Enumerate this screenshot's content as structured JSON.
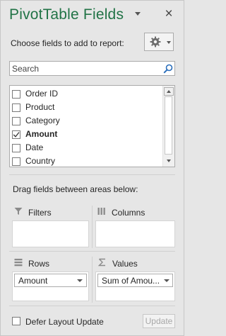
{
  "pane": {
    "title": "PivotTable Fields",
    "close_glyph": "×",
    "title_color": "#217346"
  },
  "chooser": {
    "label": "Choose fields to add to report:",
    "gear_icon": "gear-icon"
  },
  "search": {
    "placeholder": "Search",
    "value": ""
  },
  "fields": [
    {
      "label": "Order ID",
      "checked": false
    },
    {
      "label": "Product",
      "checked": false
    },
    {
      "label": "Category",
      "checked": false
    },
    {
      "label": "Amount",
      "checked": true
    },
    {
      "label": "Date",
      "checked": false
    },
    {
      "label": "Country",
      "checked": false
    }
  ],
  "areas": {
    "drag_label": "Drag fields between areas below:",
    "filters": {
      "label": "Filters",
      "icon": "filter-icon"
    },
    "columns": {
      "label": "Columns",
      "icon": "columns-icon"
    },
    "rows": {
      "label": "Rows",
      "icon": "rows-icon",
      "items": [
        "Amount"
      ]
    },
    "values": {
      "label": "Values",
      "icon": "sigma-icon",
      "items": [
        "Sum of Amou..."
      ]
    }
  },
  "footer": {
    "defer_label": "Defer Layout Update",
    "defer_checked": false,
    "update_label": "Update"
  }
}
